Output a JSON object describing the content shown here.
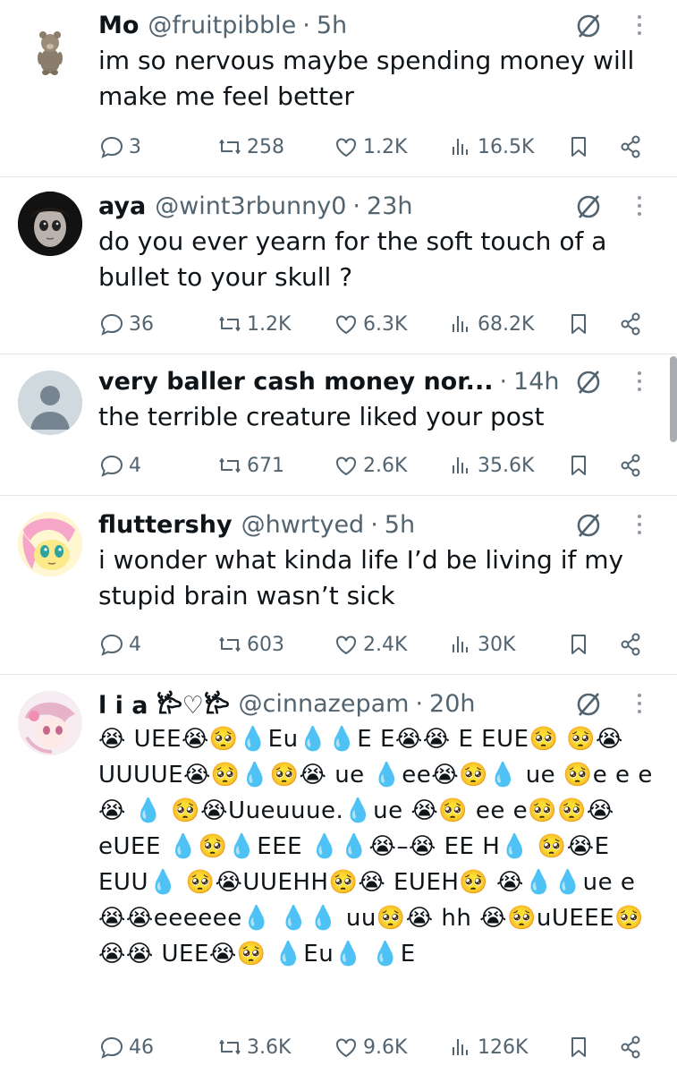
{
  "colors": {
    "text": "#0f1419",
    "muted": "#536471",
    "divider": "#e6e9ec"
  },
  "posts": [
    {
      "name": "Mo",
      "handle": "@fruitpibble",
      "sep": "·",
      "time": "5h",
      "text": "im so nervous maybe spending money will make me feel better",
      "avatar": "bear-plush-avatar",
      "stats": {
        "replies": "3",
        "reposts": "258",
        "likes": "1.2K",
        "views": "16.5K"
      }
    },
    {
      "name": "aya",
      "handle": "@wint3rbunny0",
      "sep": "·",
      "time": "23h",
      "text": "do you ever yearn for the soft touch of a bullet to your skull ?",
      "avatar": "doll-avatar",
      "stats": {
        "replies": "36",
        "reposts": "1.2K",
        "likes": "6.3K",
        "views": "68.2K"
      }
    },
    {
      "name": "very baller cash money nor...",
      "handle": "",
      "sep": "·",
      "time": "14h",
      "text": "the terrible creature liked your post",
      "avatar": "default-user-avatar",
      "stats": {
        "replies": "4",
        "reposts": "671",
        "likes": "2.6K",
        "views": "35.6K"
      }
    },
    {
      "name": "fluttershy",
      "handle": "@hwrtyed",
      "sep": "·",
      "time": "5h",
      "text": "i wonder what kinda life I’d be living if my stupid brain wasn’t sick",
      "avatar": "pony-avatar",
      "stats": {
        "replies": "4",
        "reposts": "603",
        "likes": "2.4K",
        "views": "30K"
      }
    },
    {
      "name": "l i a 𐂂♡𐂂",
      "handle": "@cinnazepam",
      "sep": "·",
      "time": "20h",
      "text": "😭 UEE😭🥺💧Eu💧💧E E😭😭 E EUE🥺 🥺😭UUUUE😭🥺💧🥺😭 ue 💧ee😭🥺💧 ue 🥺e e e😭 💧 🥺😭Uueuuue.💧ue 😭🥺 ee e🥺🥺😭eUEE 💧🥺💧EEE 💧💧😭–😭 EE H💧 🥺😭E EUU💧 🥺😭UUEHH🥺😭 EUEH🥺 😭💧💧ue e😭😭eeeeee💧 💧💧 uu🥺😭 hh 😭🥺uUEEE🥺😭😭 UEE😭🥺 💧Eu💧 💧E",
      "avatar": "anime-girl-avatar",
      "stats": {
        "replies": "46",
        "reposts": "3.6K",
        "likes": "9.6K",
        "views": "126K"
      }
    }
  ]
}
